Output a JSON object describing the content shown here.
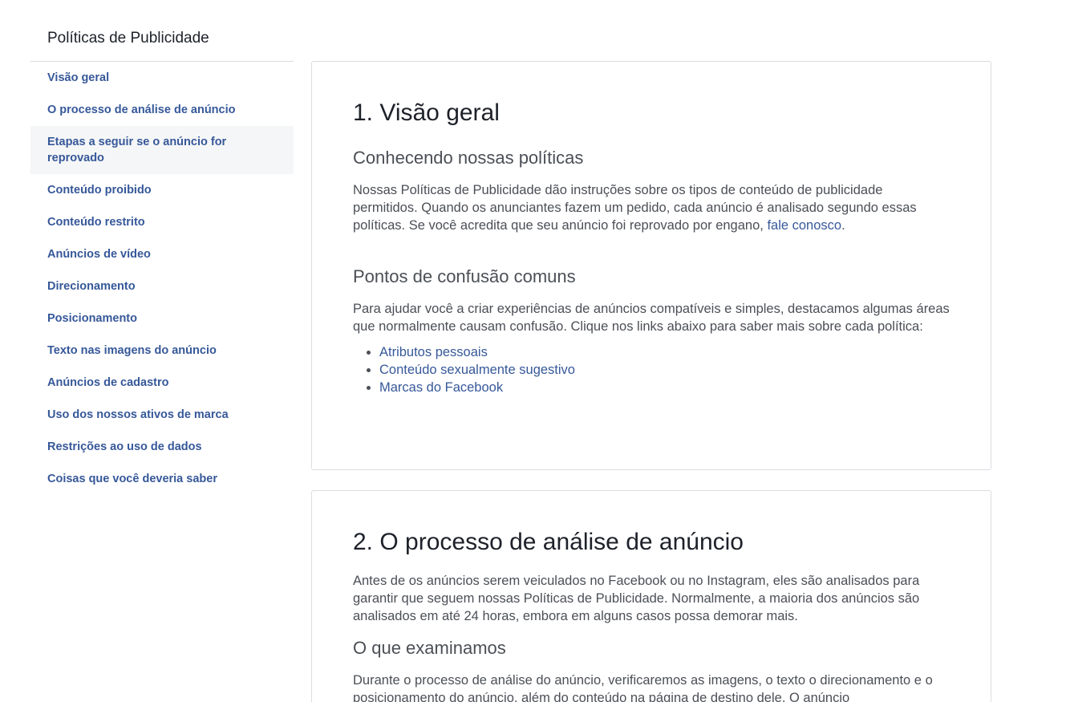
{
  "sidebar": {
    "title": "Políticas de Publicidade",
    "items": [
      {
        "label": "Visão geral"
      },
      {
        "label": "O processo de análise de anúncio"
      },
      {
        "label": "Etapas a seguir se o anúncio for reprovado",
        "active": true
      },
      {
        "label": "Conteúdo proibido"
      },
      {
        "label": "Conteúdo restrito"
      },
      {
        "label": "Anúncios de vídeo"
      },
      {
        "label": "Direcionamento"
      },
      {
        "label": "Posicionamento"
      },
      {
        "label": "Texto nas imagens do anúncio"
      },
      {
        "label": "Anúncios de cadastro"
      },
      {
        "label": "Uso dos nossos ativos de marca"
      },
      {
        "label": "Restrições ao uso de dados"
      },
      {
        "label": "Coisas que você deveria saber"
      }
    ]
  },
  "section1": {
    "heading": "1. Visão geral",
    "subheading1": "Conhecendo nossas políticas",
    "para1": "Nossas Políticas de Publicidade dão instruções sobre os tipos de conteúdo de publicidade permitidos. Quando os anunciantes fazem um pedido, cada anúncio é analisado segundo essas políticas. Se você acredita que seu anúncio foi reprovado por engano, ",
    "para1_link": "fale conosco",
    "para1_end": ".",
    "subheading2": "Pontos de confusão comuns",
    "para2": "Para ajudar você a criar experiências de anúncios compatíveis e simples, destacamos algumas áreas que normalmente causam confusão. Clique nos links abaixo para saber mais sobre cada política:",
    "links": [
      "Atributos pessoais",
      "Conteúdo sexualmente sugestivo",
      "Marcas do Facebook"
    ]
  },
  "section2": {
    "heading": "2. O processo de análise de anúncio",
    "para1": "Antes de os anúncios serem veiculados no Facebook ou no Instagram, eles são analisados para garantir que seguem nossas Políticas de Publicidade. Normalmente, a maioria dos anúncios são analisados em até 24 horas, embora em alguns casos possa demorar mais.",
    "subheading": "O que examinamos",
    "para2": "Durante o processo de análise do anúncio, verificaremos as imagens, o texto o direcionamento e o posicionamento do anúncio, além do conteúdo na página de destino dele. O anúncio"
  }
}
